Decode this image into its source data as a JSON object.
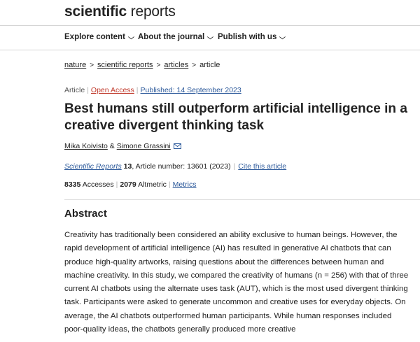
{
  "header": {
    "logo_bold": "scientific",
    "logo_rest": " reports"
  },
  "nav": {
    "items": [
      {
        "label": "Explore content"
      },
      {
        "label": "About the journal"
      },
      {
        "label": "Publish with us"
      }
    ]
  },
  "breadcrumb": [
    "nature",
    "scientific reports",
    "articles",
    "article"
  ],
  "article_meta": {
    "type": "Article",
    "access": "Open Access",
    "published": "Published: 14 September 2023"
  },
  "title": "Best humans still outperform artificial intelligence in a creative divergent thinking task",
  "authors": {
    "author1": "Mika Koivisto",
    "joiner": " & ",
    "author2": "Simone Grassini"
  },
  "citation": {
    "journal": "Scientific Reports",
    "volume": "13",
    "details": ", Article number: 13601 (2023)",
    "cite_link": "Cite this article"
  },
  "metrics": {
    "accesses_count": "8335",
    "accesses_label": "Accesses",
    "altmetric_count": "2079",
    "altmetric_label": "Altmetric",
    "metrics_link": "Metrics"
  },
  "abstract": {
    "heading": "Abstract",
    "text": "Creativity has traditionally been considered an ability exclusive to human beings. However, the rapid development of artificial intelligence (AI) has resulted in generative AI chatbots that can produce high-quality artworks, raising questions about the differences between human and machine creativity. In this study, we compared the creativity of humans (n = 256) with that of three current AI chatbots using the alternate uses task (AUT), which is the most used divergent thinking task. Participants were asked to generate uncommon and creative uses for everyday objects. On average, the AI chatbots outperformed human participants. While human responses included poor-quality ideas, the chatbots generally produced more creative"
  },
  "colors": {
    "link_blue": "#2d5a9b",
    "open_access_orange": "#c0392b"
  }
}
